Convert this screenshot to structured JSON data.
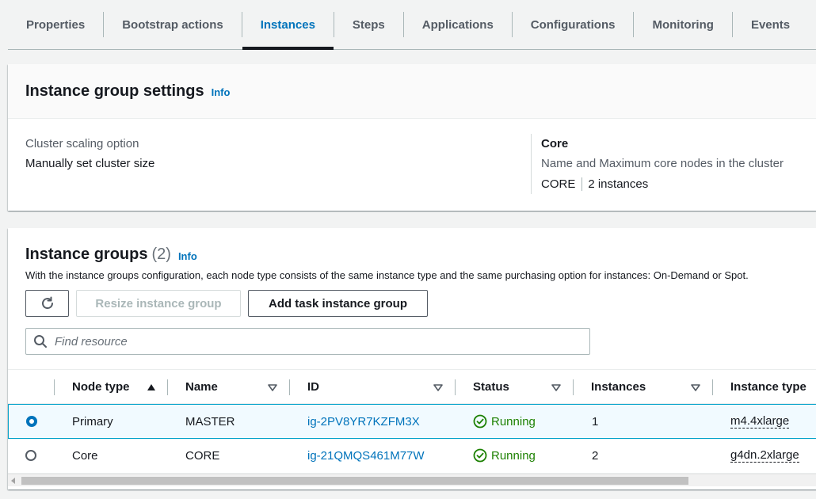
{
  "tabs": [
    {
      "label": "Properties",
      "active": false
    },
    {
      "label": "Bootstrap actions",
      "active": false
    },
    {
      "label": "Instances",
      "active": true
    },
    {
      "label": "Steps",
      "active": false
    },
    {
      "label": "Applications",
      "active": false
    },
    {
      "label": "Configurations",
      "active": false
    },
    {
      "label": "Monitoring",
      "active": false
    },
    {
      "label": "Events",
      "active": false
    }
  ],
  "settings": {
    "title": "Instance group settings",
    "info": "Info",
    "scaling_label": "Cluster scaling option",
    "scaling_value": "Manually set cluster size",
    "core_title": "Core",
    "core_desc": "Name and Maximum core nodes in the cluster",
    "core_name": "CORE",
    "core_instances": "2 instances"
  },
  "groups": {
    "title": "Instance groups",
    "count": "(2)",
    "info": "Info",
    "description": "With the instance groups configuration, each node type consists of the same instance type and the same purchasing option for instances: On-Demand or Spot.",
    "resize_label": "Resize instance group",
    "add_label": "Add task instance group",
    "search_placeholder": "Find resource"
  },
  "table": {
    "columns": {
      "node_type": "Node type",
      "name": "Name",
      "id": "ID",
      "status": "Status",
      "instances": "Instances",
      "instance_type": "Instance type"
    },
    "rows": [
      {
        "node_type": "Primary",
        "name": "MASTER",
        "id": "ig-2PV8YR7KZFM3X",
        "status": "Running",
        "instances": "1",
        "instance_type": "m4.4xlarge",
        "selected": true
      },
      {
        "node_type": "Core",
        "name": "CORE",
        "id": "ig-21QMQS461M77W",
        "status": "Running",
        "instances": "2",
        "instance_type": "g4dn.2xlarge",
        "selected": false
      }
    ]
  },
  "colors": {
    "link": "#0073bb",
    "success": "#1d8102",
    "selection": "#f1faff"
  },
  "icons": [
    "refresh-icon",
    "search-icon",
    "sort-ascending-icon",
    "filter-caret-icon",
    "status-success-icon"
  ]
}
